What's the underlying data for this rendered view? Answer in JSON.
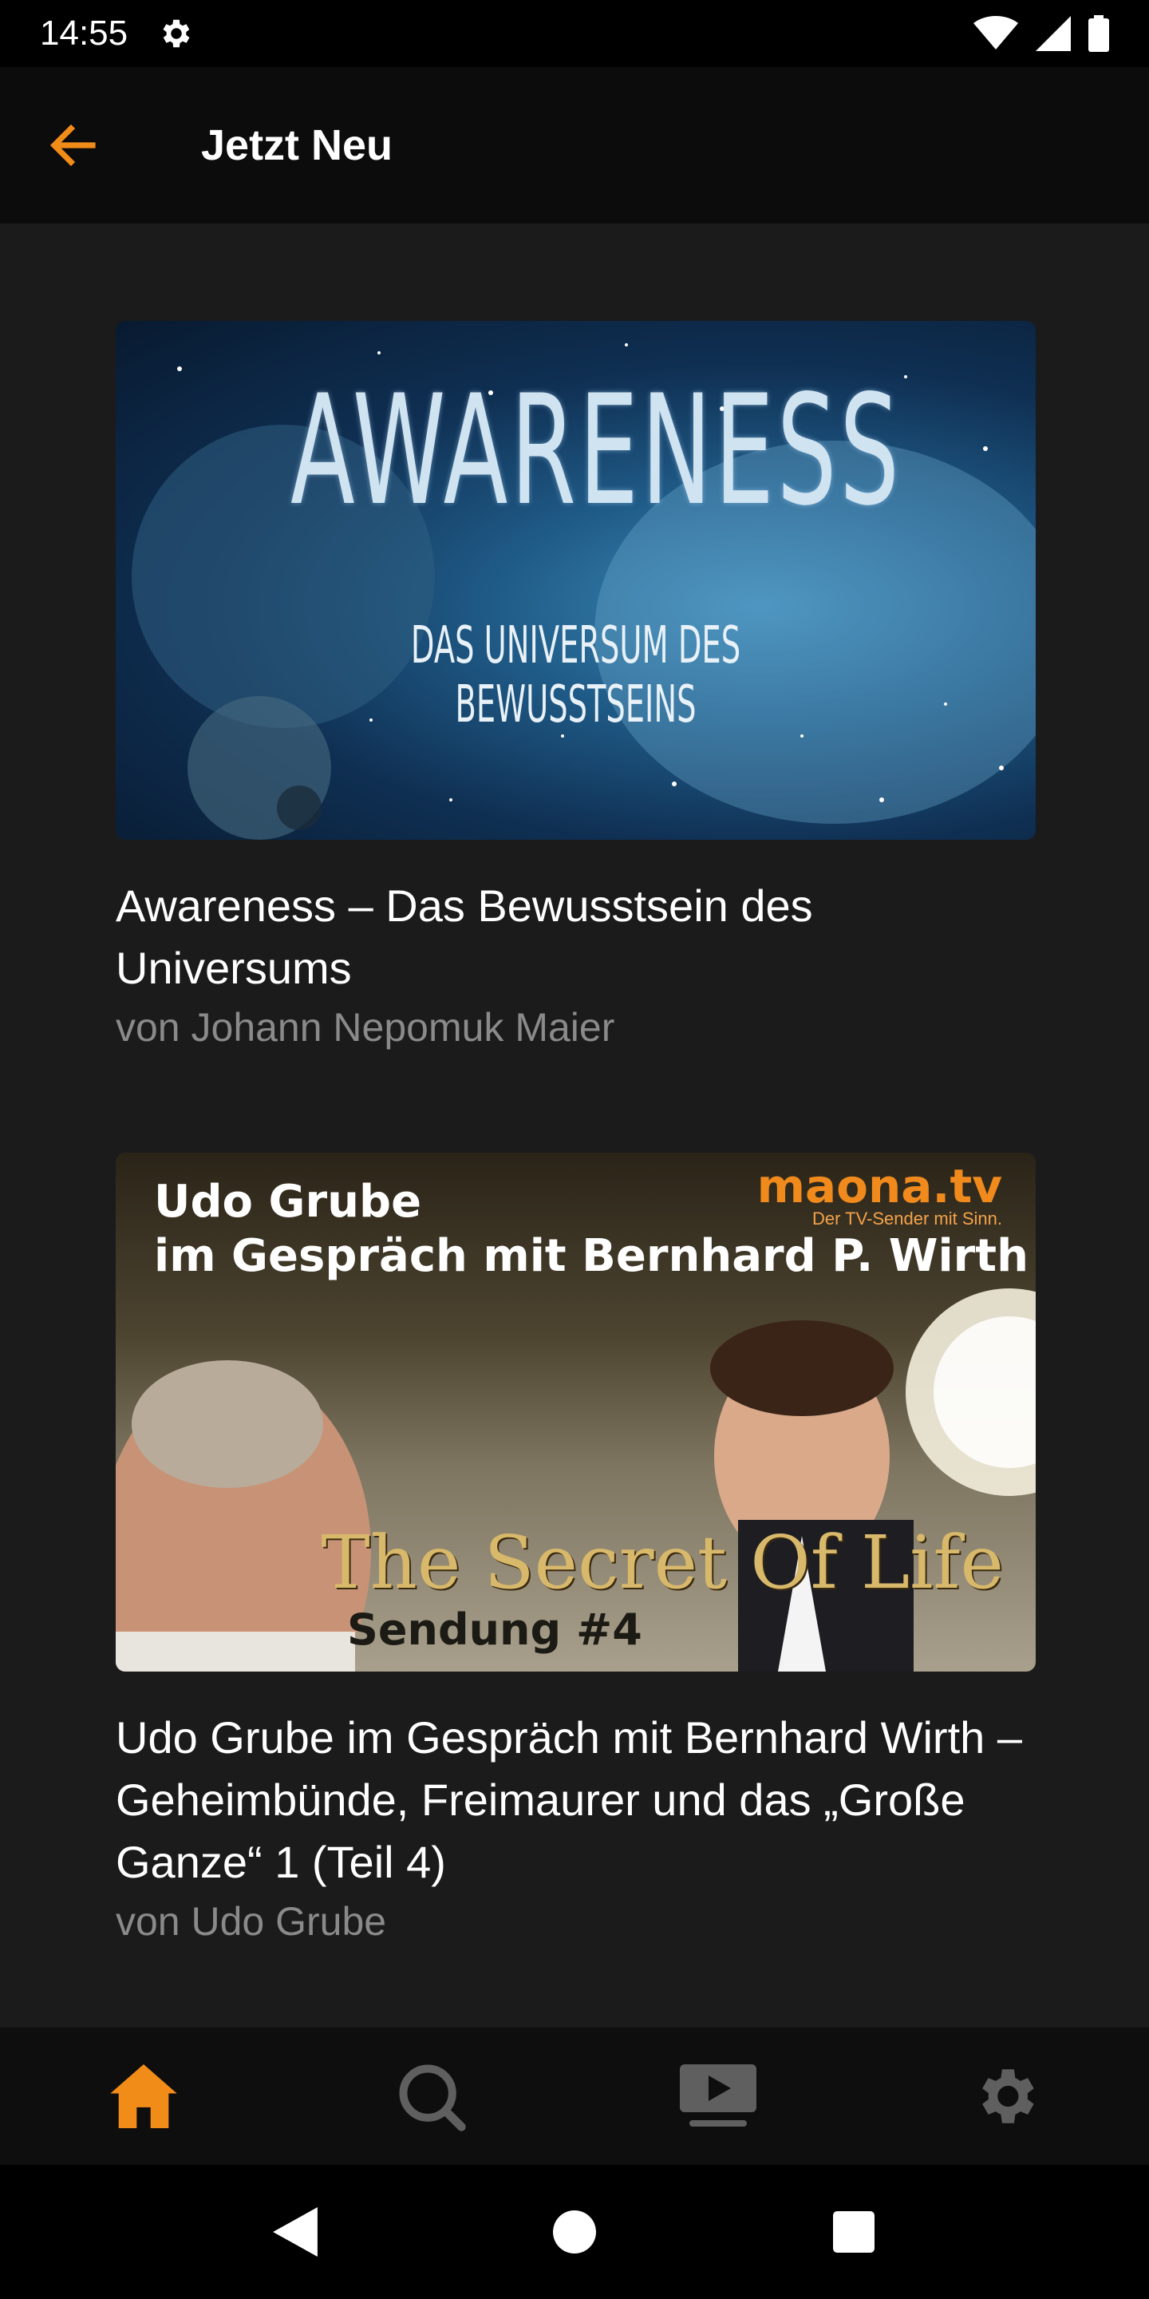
{
  "status_bar": {
    "time": "14:55",
    "icons": [
      "settings-icon",
      "wifi-icon",
      "signal-icon",
      "battery-icon"
    ]
  },
  "app_bar": {
    "title": "Jetzt Neu",
    "back_icon": "arrow-left-icon",
    "accent_color": "#f28c18"
  },
  "items": [
    {
      "title": "Awareness – Das Bewusstsein des Universums",
      "author": "von Johann Nepomuk Maier",
      "thumbnail": {
        "headline": "AWARENESS",
        "subtitle": "DAS UNIVERSUM DES BEWUSSTSEINS"
      }
    },
    {
      "title": "Udo Grube im Gespräch mit Bernhard Wirth – Geheimbünde, Freimaurer und das „Große Ganze“ 1 (Teil 4)",
      "author": "von Udo Grube",
      "thumbnail": {
        "headline_line1": "Udo Grube",
        "headline_line2": "im Gespräch mit Bernhard P. Wirth",
        "brand": "maona.tv",
        "slogan": "Der TV-Sender mit Sinn.",
        "show_title": "The Secret Of Life",
        "episode": "Sendung #4"
      }
    }
  ],
  "bottom_nav": [
    {
      "name": "home",
      "icon": "home-icon",
      "active": true
    },
    {
      "name": "search",
      "icon": "search-icon",
      "active": false
    },
    {
      "name": "videos",
      "icon": "video-library-icon",
      "active": false
    },
    {
      "name": "settings",
      "icon": "gear-icon",
      "active": false
    }
  ],
  "system_nav": [
    "back-triangle-icon",
    "home-circle-icon",
    "recents-square-icon"
  ],
  "colors": {
    "background": "#1b1b1b",
    "accent": "#f28c18",
    "inactive_icon": "#5f5f5f",
    "secondary_text": "#8a8a8a"
  }
}
